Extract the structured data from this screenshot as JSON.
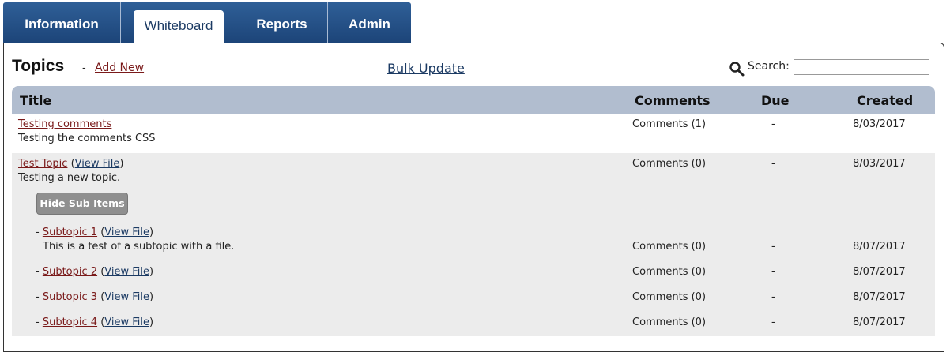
{
  "tabs": [
    "Information",
    "Whiteboard",
    "Reports",
    "Admin"
  ],
  "page": {
    "title": "Topics",
    "dash": "-",
    "add_new": "Add New",
    "bulk_update": "Bulk Update",
    "search_label": "Search:",
    "search_value": ""
  },
  "table": {
    "headers": {
      "title": "Title",
      "comments": "Comments",
      "due": "Due",
      "created": "Created"
    }
  },
  "topics": [
    {
      "title": "Testing comments",
      "desc": "Testing the comments CSS",
      "comments": "Comments (1)",
      "due": "-",
      "created": "8/03/2017"
    },
    {
      "title": "Test Topic",
      "view_file": "View File",
      "desc": "Testing a new topic.",
      "comments": "Comments (0)",
      "due": "-",
      "created": "8/03/2017"
    }
  ],
  "hide_sub_items": "Hide Sub Items",
  "subtopics": [
    {
      "prefix": "-",
      "title": "Subtopic 1",
      "view_file": "View File",
      "desc": "This is a test of a subtopic with a file.",
      "comments": "Comments (0)",
      "due": "-",
      "created": "8/07/2017"
    },
    {
      "prefix": "-",
      "title": "Subtopic 2",
      "view_file": "View File",
      "comments": "Comments (0)",
      "due": "-",
      "created": "8/07/2017"
    },
    {
      "prefix": "-",
      "title": "Subtopic 3",
      "view_file": "View File",
      "comments": "Comments (0)",
      "due": "-",
      "created": "8/07/2017"
    },
    {
      "prefix": "-",
      "title": "Subtopic 4",
      "view_file": "View File",
      "comments": "Comments (0)",
      "due": "-",
      "created": "8/07/2017"
    }
  ]
}
